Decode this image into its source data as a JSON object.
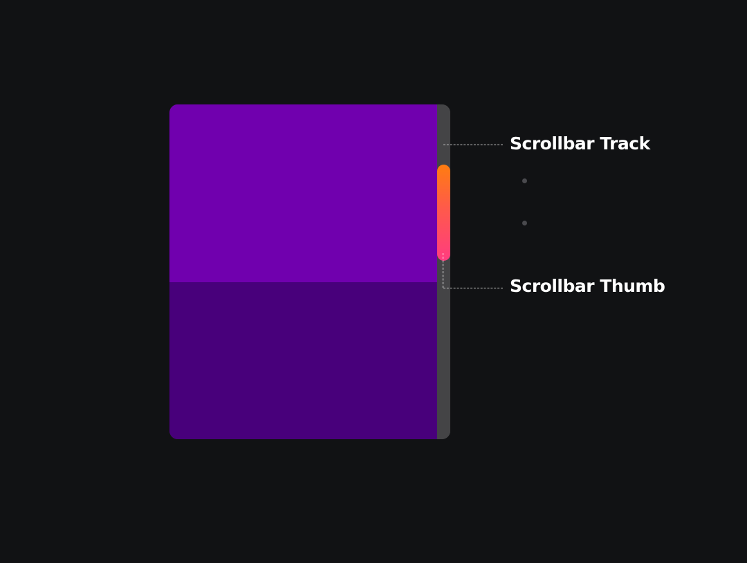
{
  "labels": {
    "track": "Scrollbar Track",
    "thumb": "Scrollbar Thumb"
  },
  "colors": {
    "background": "#111214",
    "content_top": "#7000ae",
    "content_bottom": "#48007b",
    "track": "#444446",
    "thumb_gradient_start": "#ff7d10",
    "thumb_gradient_end": "#ff3c80",
    "label_text": "#ffffff",
    "connector": "#cfcfcf",
    "dot": "#4a4a4e"
  }
}
